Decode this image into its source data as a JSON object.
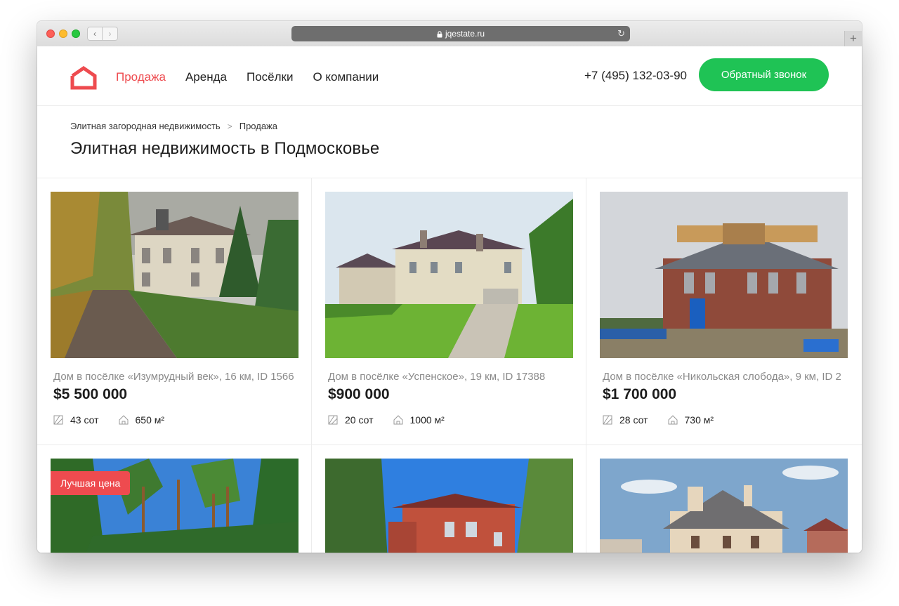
{
  "browser": {
    "url": "jqestate.ru",
    "back_label": "‹",
    "forward_label": "›",
    "reload_label": "↻",
    "new_tab_label": "+"
  },
  "header": {
    "nav": [
      "Продажа",
      "Аренда",
      "Посёлки",
      "О компании"
    ],
    "active_nav": "Продажа",
    "phone": "+7 (495) 132-03-90",
    "callback_label": "Обратный звонок",
    "brand_color": "#ee4b4f",
    "cta_color": "#1fc355"
  },
  "breadcrumbs": [
    "Элитная загородная недвижимость",
    "Продажа"
  ],
  "breadcrumb_separator": ">",
  "page_title": "Элитная недвижимость в Подмосковье",
  "listings": [
    {
      "title": "Дом в посёлке «Изумрудный век», 16 км, ID 1566",
      "price": "$5 500 000",
      "land": "43 сот",
      "area": "650 м²"
    },
    {
      "title": "Дом в посёлке «Успенское», 19 км, ID 17388",
      "price": "$900 000",
      "land": "20 сот",
      "area": "1000 м²"
    },
    {
      "title": "Дом в посёлке «Никольская слобода», 9 км, ID 2",
      "price": "$1 700 000",
      "land": "28 сот",
      "area": "730 м²"
    },
    {
      "badge": "Лучшая цена"
    },
    {},
    {}
  ]
}
